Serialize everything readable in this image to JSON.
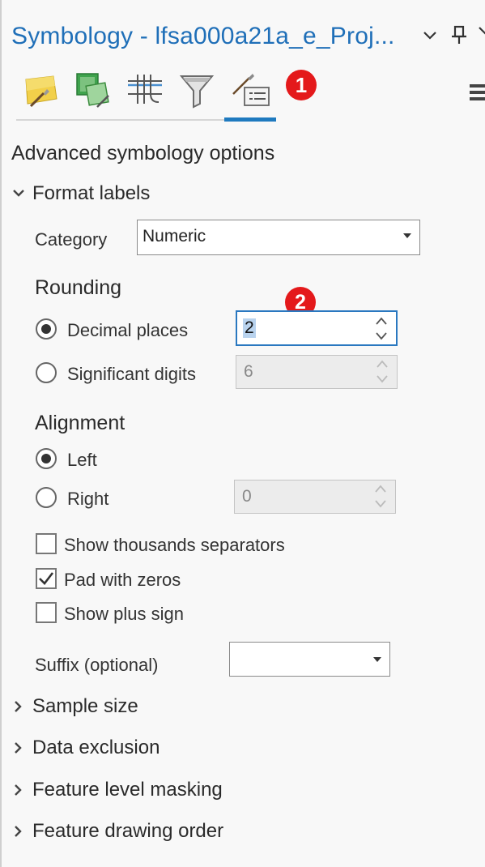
{
  "header": {
    "title": "Symbology - lfsa000a21a_e_Proj...",
    "badge1": "1",
    "badge2": "2"
  },
  "toolbar": {
    "icons": [
      "primary-symbology-icon",
      "vary-symbology-icon",
      "symbol-layer-drawing-icon",
      "symbology-filter-icon",
      "advanced-symbology-icon"
    ],
    "active_index": 4
  },
  "panel": {
    "heading": "Advanced symbology options",
    "format_labels": {
      "label": "Format labels",
      "category_label": "Category",
      "category_value": "Numeric",
      "rounding_heading": "Rounding",
      "decimal_places_label": "Decimal places",
      "decimal_places_value": "2",
      "significant_digits_label": "Significant digits",
      "significant_digits_value": "6",
      "alignment_heading": "Alignment",
      "left_label": "Left",
      "right_label": "Right",
      "right_value": "0",
      "thousands_label": "Show thousands separators",
      "pad_zeros_label": "Pad with zeros",
      "plus_sign_label": "Show plus sign",
      "suffix_label": "Suffix (optional)",
      "suffix_value": ""
    },
    "collapsed_sections": [
      "Sample size",
      "Data exclusion",
      "Feature level masking",
      "Feature drawing order"
    ]
  },
  "colors": {
    "accent": "#1f7abf",
    "title": "#1f6fb8",
    "badge": "#e4191b"
  }
}
